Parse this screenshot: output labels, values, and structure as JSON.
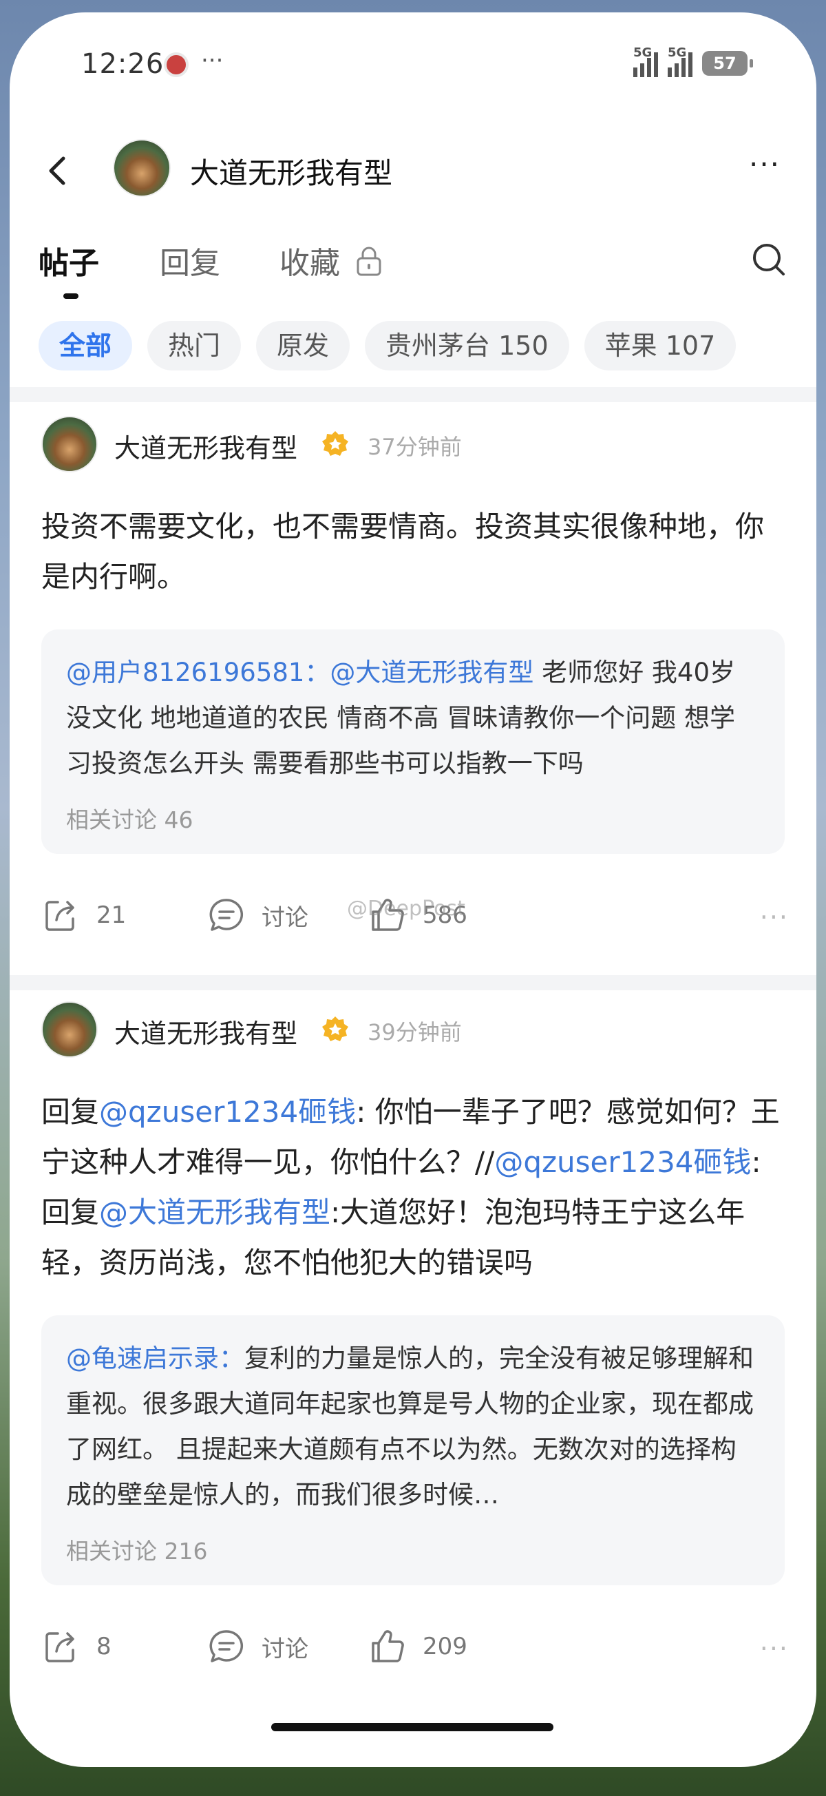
{
  "status_bar": {
    "time": "12:26",
    "dots": "···",
    "signal1": "5G",
    "signal2": "5G",
    "battery": "57"
  },
  "header": {
    "title": "大道无形我有型",
    "more": "···"
  },
  "tabs": [
    {
      "label": "帖子"
    },
    {
      "label": "回复"
    },
    {
      "label": "收藏"
    }
  ],
  "chips": [
    "全部",
    "热门",
    "原发",
    "贵州茅台 150",
    "苹果 107"
  ],
  "posts": [
    {
      "author": "大道无形我有型",
      "time": "37分钟前",
      "text": "投资不需要文化，也不需要情商。投资其实很像种地，你是内行啊。",
      "quote": {
        "mention": "@用户8126196581：@大道无形我有型",
        "text": " 老师您好 我40岁 没文化 地地道道的农民 情商不高 冒昧请教你一个问题 想学习投资怎么开头 需要看那些书可以指教一下吗",
        "meta": "相关讨论 46"
      },
      "share_count": "21",
      "discuss_label": "讨论",
      "like_count": "586",
      "watermark": "@DeepPost"
    },
    {
      "author": "大道无形我有型",
      "time": "39分钟前",
      "text_parts": {
        "p1": "回复",
        "m1": "@qzuser1234砸钱",
        "p2": ": 你怕一辈子了吧？感觉如何？王宁这种人才难得一见，你怕什么？//",
        "m2": "@qzuser1234砸钱",
        "p3": ":回复",
        "m3": "@大道无形我有型",
        "p4": ":大道您好！泡泡玛特王宁这么年轻，资历尚浅，您不怕他犯大的错误吗"
      },
      "quote": {
        "mention": "@龟速启示录：",
        "text": "复利的力量是惊人的，完全没有被足够理解和重视。很多跟大道同年起家也算是号人物的企业家，现在都成了网红。 且提起来大道颇有点不以为然。无数次对的选择构成的壁垒是惊人的，而我们很多时候…",
        "meta": "相关讨论 216"
      },
      "share_count": "8",
      "discuss_label": "讨论",
      "like_count": "209"
    }
  ],
  "colors": {
    "accent": "#2f74ec",
    "mention": "#3d78d8",
    "badge": "#f5b324"
  }
}
